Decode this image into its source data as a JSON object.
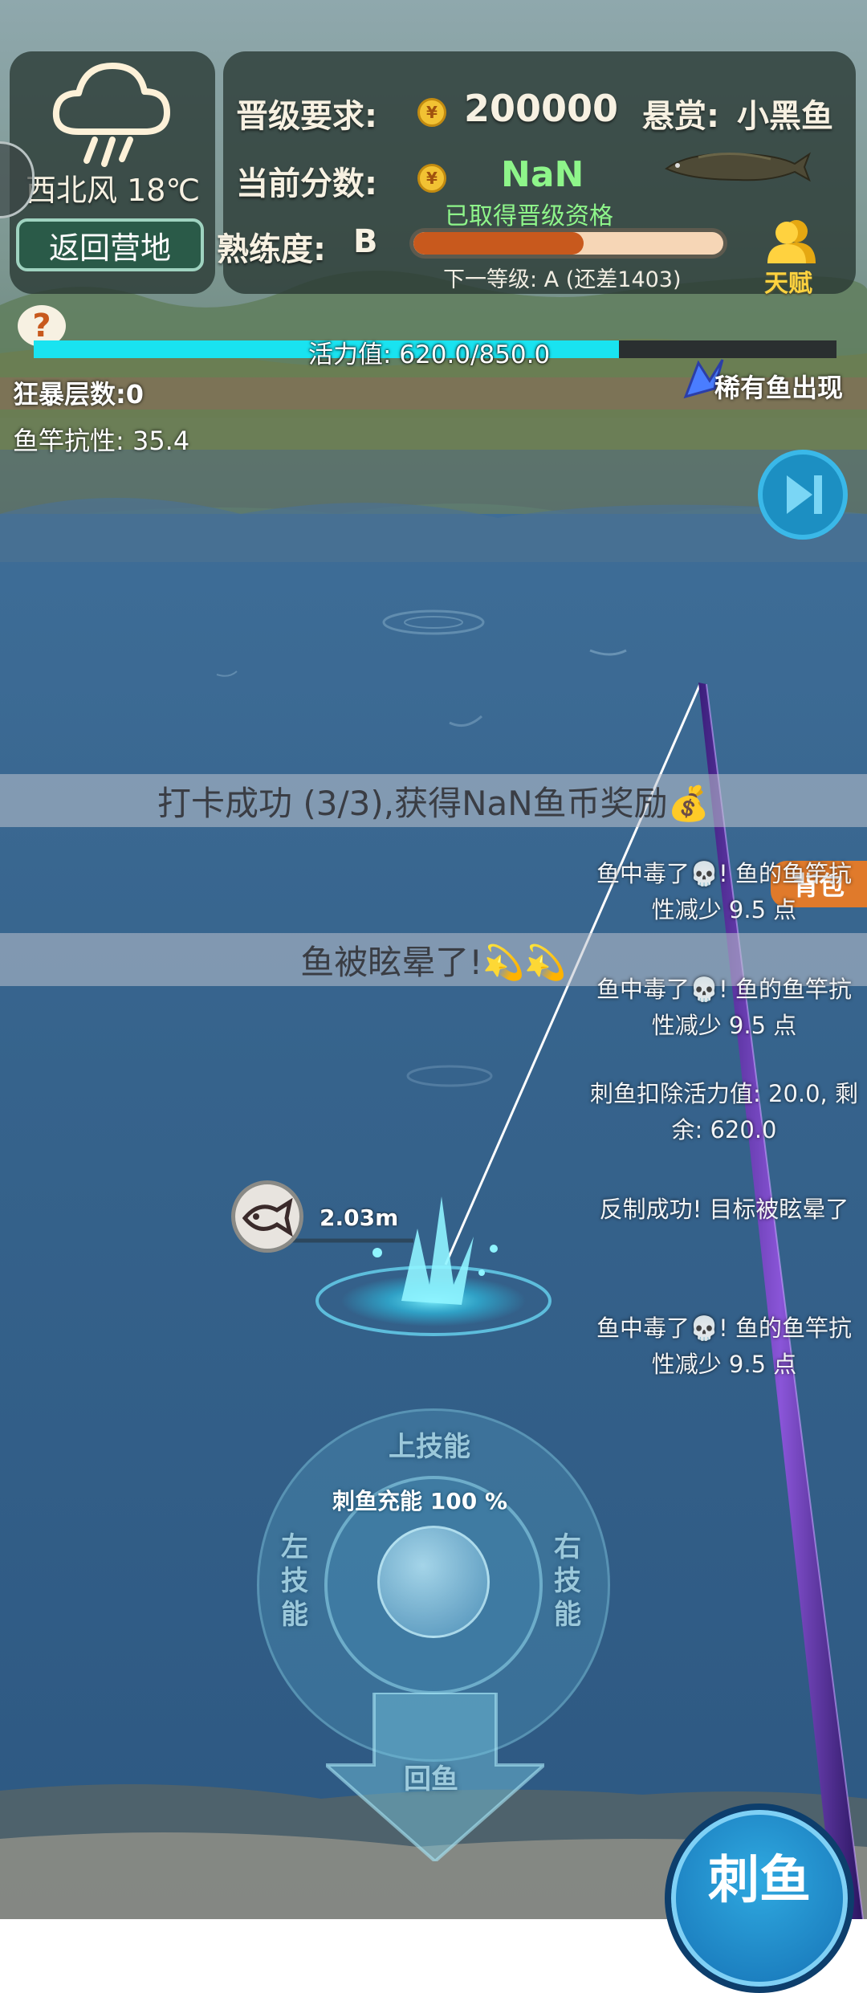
{
  "weather": {
    "wind": "西北风",
    "temperature": "18℃",
    "icon": "rain-cloud-icon"
  },
  "camp_button": "返回营地",
  "header": {
    "promotion_label": "晋级要求:",
    "promotion_value": "200000",
    "score_label": "当前分数:",
    "score_value": "NaN",
    "qualified_text": "已取得晋级资格",
    "bounty_label": "悬赏:",
    "bounty_fish": "小黑鱼",
    "proficiency_label": "熟练度:",
    "proficiency_grade": "B",
    "proficiency_progress": 0.55,
    "next_level_text": "下一等级: A (还差1403)",
    "talent_label": "天赋"
  },
  "help_icon": "question-icon",
  "vitality": {
    "text": "活力值: 620.0/850.0",
    "current": 620.0,
    "max": 850.0
  },
  "rage_text": "狂暴层数:0",
  "rod_resistance_text": "鱼竿抗性: 35.4",
  "rare_fish_text": "稀有鱼出现",
  "backpack_label": "背包",
  "banners": {
    "checkin": "打卡成功 (3/3),获得NaN鱼币奖励💰",
    "stun": "鱼被眩晕了!💫💫"
  },
  "log_messages": [
    "鱼中毒了💀! 鱼的鱼竿抗性减少 9.5 点",
    "鱼中毒了💀! 鱼的鱼竿抗性减少 9.5 点",
    "刺鱼扣除活力值: 20.0, 剩余: 620.0",
    "反制成功! 目标被眩晕了",
    "鱼中毒了💀! 鱼的鱼竿抗性减少 9.5 点"
  ],
  "fish_distance": "2.03m",
  "joystick": {
    "charge_text": "刺鱼充能 100 %",
    "up_skill": "上技能",
    "left_skill": "左技能",
    "right_skill": "右技能",
    "reel": "回鱼"
  },
  "stab_button": "刺鱼",
  "colors": {
    "vitality_bar": "#19e3f0",
    "proficiency_bar": "#c8591d",
    "score_green": "#8ef58a",
    "accent_gold": "#f2c233"
  }
}
